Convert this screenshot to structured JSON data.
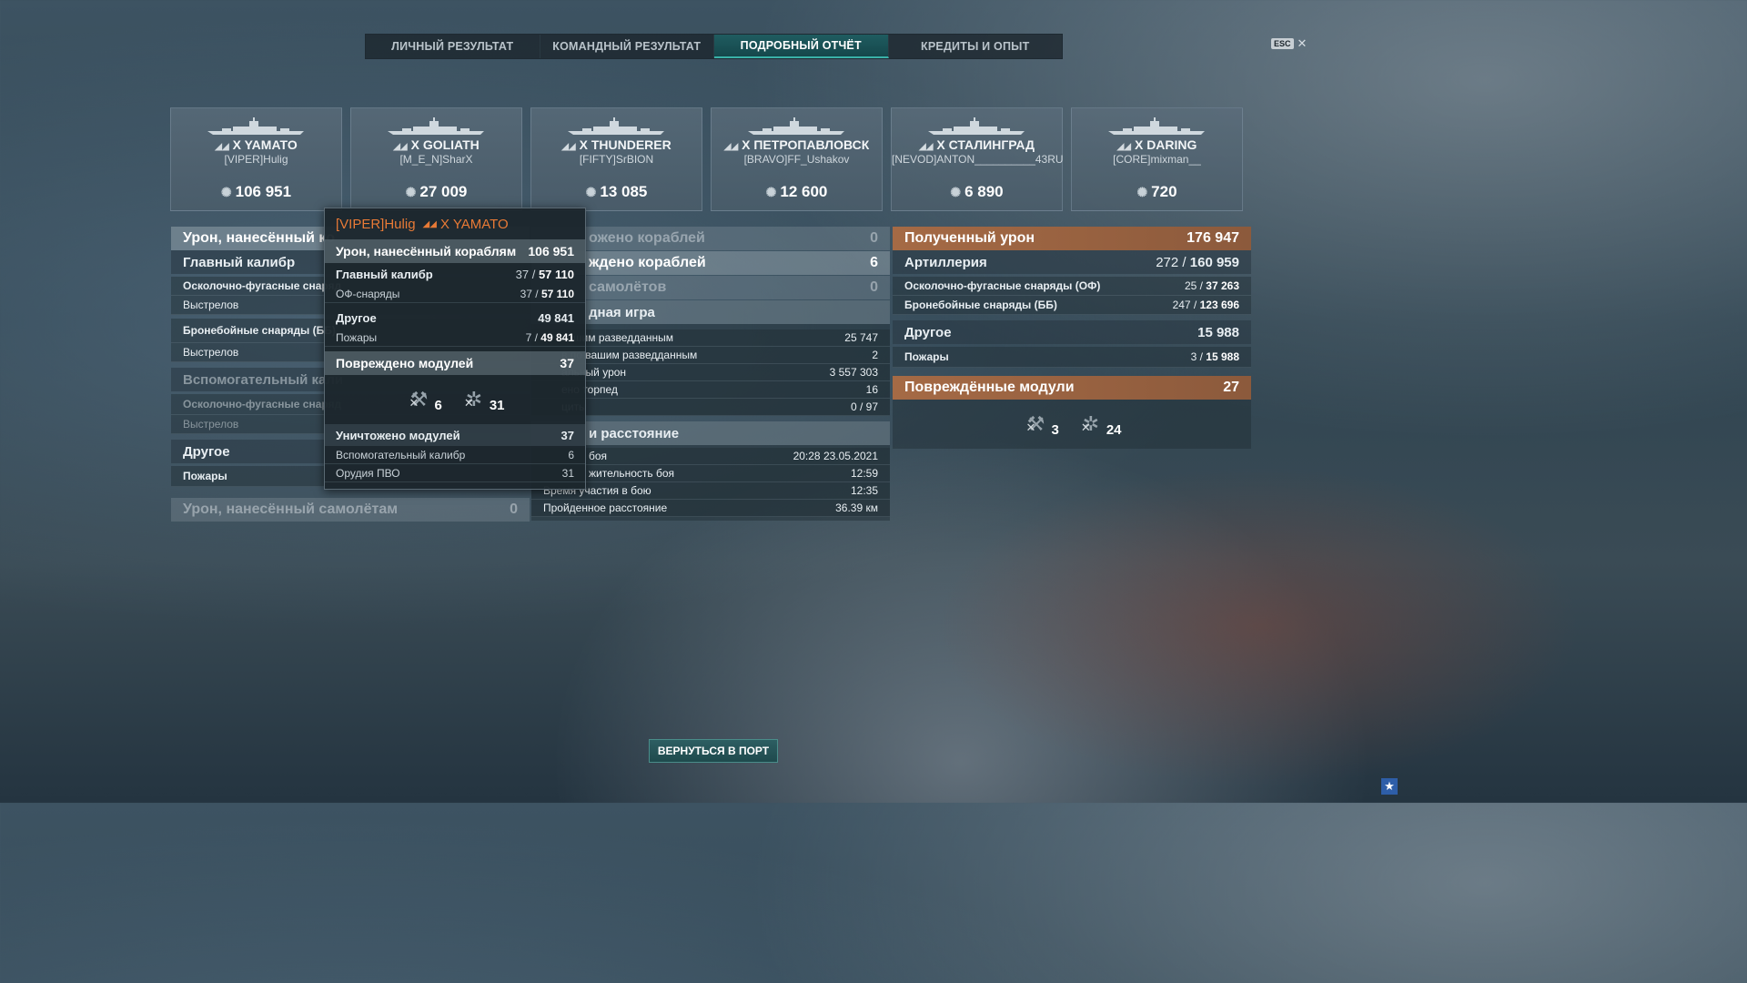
{
  "tabs": [
    "ЛИЧНЫЙ РЕЗУЛЬТАТ",
    "КОМАНДНЫЙ РЕЗУЛЬТАТ",
    "ПОДРОБНЫЙ ОТЧЁТ",
    "КРЕДИТЫ И ОПЫТ"
  ],
  "active_tab": "ПОДРОБНЫЙ ОТЧЁТ",
  "esc_label": "ESC",
  "players": [
    {
      "ship": "X YAMATO",
      "player": "[VIPER]Hulig",
      "damage": "106 951"
    },
    {
      "ship": "X GOLIATH",
      "player": "[M_E_N]SharX",
      "damage": "27 009"
    },
    {
      "ship": "X THUNDERER",
      "player": "[FIFTY]SrBION",
      "damage": "13 085"
    },
    {
      "ship": "X ПЕТРОПАВЛОВСК",
      "player": "[BRAVO]FF_Ushakov",
      "damage": "12 600"
    },
    {
      "ship": "X СТАЛИНГРАД",
      "player": "[NEVOD]ANTON__________43RU",
      "damage": "6 890"
    },
    {
      "ship": "X DARING",
      "player": "[CORE]mixman__",
      "damage": "720"
    }
  ],
  "left": {
    "damage_ships": "Урон, нанесённый ко",
    "main_battery": "Главный калибр",
    "he": "Осколочно-фугасные снаряд",
    "shots": "Выстрелов",
    "ap": "Бронебойные снаряды (ББ)",
    "shots2": "Выстрелов",
    "secondary": "Вспомогательный кали",
    "sec_he": "Осколочно-фугасные снаряд",
    "sec_shots": "Выстрелов",
    "other": "Другое",
    "fires": "Пожары",
    "damage_planes": "Урон, нанесённый самолётам",
    "damage_planes_value": "0"
  },
  "middle": {
    "destroyed_ships": "ожено кораблей",
    "destroyed_ships_value": "0",
    "damaged_ships": "ждено кораблей",
    "damaged_ships_value": "6",
    "planes": "самолётов",
    "planes_value": "0",
    "team_game": "дная игра",
    "rows": [
      {
        "label": "вашим разведданным",
        "value": "25 747"
      },
      {
        "label": "в по вашим разведданным",
        "value": "2"
      },
      {
        "label": "альный урон",
        "value": "3 557 303"
      },
      {
        "label": "ено торпед",
        "value": "16"
      },
      {
        "label": "циты",
        "value": "0 / 97"
      }
    ],
    "time_header": "и расстояние",
    "time_rows": [
      {
        "label": "боя",
        "value": "20:28  23.05.2021"
      },
      {
        "label": "жительность боя",
        "value": "12:59"
      },
      {
        "label": "Время участия в бою",
        "value": "12:35"
      },
      {
        "label": "Пройденное расстояние",
        "value": "36.39 км"
      }
    ]
  },
  "right": {
    "received": "Полученный урон",
    "received_value": "176 947",
    "artillery": "Артиллерия",
    "artillery_hits": "272 /",
    "artillery_value": "160 959",
    "he": "Осколочно-фугасные снаряды (ОФ)",
    "he_hits": "25 /",
    "he_value": "37 263",
    "ap": "Бронебойные снаряды (ББ)",
    "ap_hits": "247 /",
    "ap_value": "123 696",
    "other": "Другое",
    "other_value": "15 988",
    "fires": "Пожары",
    "fires_hits": "3 /",
    "fires_value": "15 988",
    "modules": "Повреждённые модули",
    "modules_value": "27",
    "module_counts": [
      "3",
      "24"
    ]
  },
  "tooltip": {
    "player": "[VIPER]Hulig",
    "ship": "X YAMATO",
    "damage_ships": "Урон, нанесённый кораблям",
    "damage_ships_value": "106 951",
    "main_battery": "Главный калибр",
    "main_hits": "37 /",
    "main_value": "57 110",
    "he": "ОФ-снаряды",
    "he_hits": "37 /",
    "he_value": "57 110",
    "other": "Другое",
    "other_value": "49 841",
    "fires": "Пожары",
    "fires_hits": "7 /",
    "fires_value": "49 841",
    "modules_damaged": "Повреждено модулей",
    "modules_damaged_value": "37",
    "module_counts": [
      "6",
      "31"
    ],
    "modules_destroyed": "Уничтожено модулей",
    "modules_destroyed_value": "37",
    "secondary": "Вспомогательный калибр",
    "secondary_value": "6",
    "aa": "Орудия ПВО",
    "aa_value": "31"
  },
  "back_button": "ВЕРНУТЬСЯ В ПОРТ",
  "colors": {
    "accent": "#3ab1a8",
    "orange": "#e87a36",
    "received_header": "#a56a45"
  }
}
